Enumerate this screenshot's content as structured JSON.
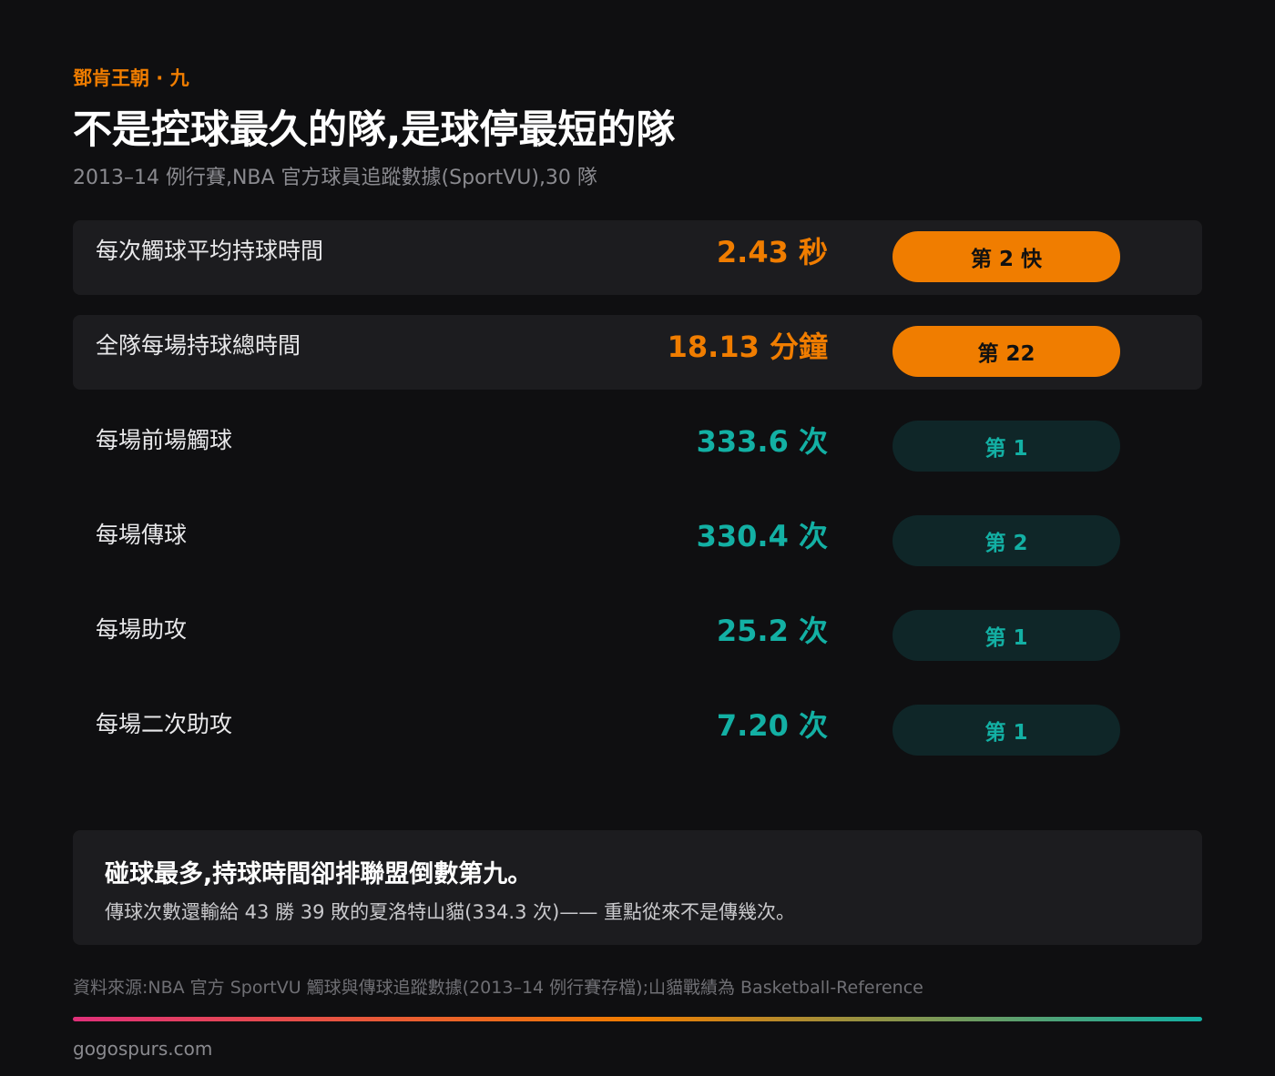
{
  "header": {
    "eyebrow": "鄧肯王朝 · 九",
    "title": "不是控球最久的隊,是球停最短的隊",
    "subtitle": "2013–14 例行賽,NBA 官方球員追蹤數據(SportVU),30 隊"
  },
  "chart_data": {
    "type": "table",
    "rows": [
      {
        "label": "每次觸球平均持球時間",
        "value": "2.43 秒",
        "rank": "第 2 快",
        "style": "orange",
        "highlight": true
      },
      {
        "label": "全隊每場持球總時間",
        "value": "18.13 分鐘",
        "rank": "第 22",
        "style": "orange",
        "highlight": true
      },
      {
        "label": "每場前場觸球",
        "value": "333.6 次",
        "rank": "第 1",
        "style": "teal",
        "highlight": false
      },
      {
        "label": "每場傳球",
        "value": "330.4 次",
        "rank": "第 2",
        "style": "teal",
        "highlight": false
      },
      {
        "label": "每場助攻",
        "value": "25.2 次",
        "rank": "第 1",
        "style": "teal",
        "highlight": false
      },
      {
        "label": "每場二次助攻",
        "value": "7.20 次",
        "rank": "第 1",
        "style": "teal",
        "highlight": false
      }
    ]
  },
  "note": {
    "headline": "碰球最多,持球時間卻排聯盟倒數第九。",
    "body": "傳球次數還輸給 43 勝 39 敗的夏洛特山貓(334.3 次)—— 重點從來不是傳幾次。"
  },
  "footer": {
    "source": "資料來源:NBA 官方 SportVU 觸球與傳球追蹤數據(2013–14 例行賽存檔);山貓戰績為 Basketball-Reference",
    "site": "gogospurs.com"
  },
  "colors": {
    "accent_orange": "#f07d00",
    "accent_teal": "#13b0a4",
    "background": "#0f0f11",
    "panel": "#1c1c1f"
  }
}
